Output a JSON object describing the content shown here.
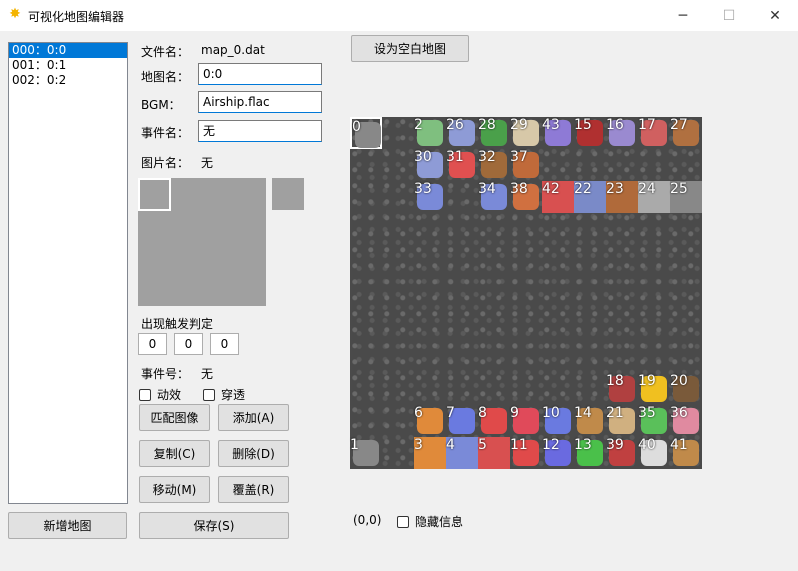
{
  "window": {
    "title": "可视化地图编辑器",
    "minimize": "─",
    "maximize": "☐",
    "close": "✕"
  },
  "maplist": {
    "items": [
      "000：0:0",
      "001：0:1",
      "002：0:2"
    ],
    "selected": 0
  },
  "form": {
    "filename_label": "文件名：",
    "filename_value": "map_0.dat",
    "mapname_label": "地图名：",
    "mapname_value": "0:0",
    "bgm_label": "BGM：",
    "bgm_value": "Airship.flac",
    "event_label": "事件名：",
    "event_value": "无",
    "image_label": "图片名：",
    "image_value": "无",
    "trigger_label": "出现触发判定",
    "trigger_values": [
      "0",
      "0",
      "0"
    ],
    "event_no_label": "事件号：",
    "event_no_value": "无",
    "anim_label": "动效",
    "pass_label": "穿透"
  },
  "buttons": {
    "set_blank": "设为空白地图",
    "match_image": "匹配图像",
    "add": "添加(A)",
    "copy": "复制(C)",
    "delete": "删除(D)",
    "move": "移动(M)",
    "overwrite": "覆盖(R)",
    "new_map": "新增地图",
    "save": "保存(S)"
  },
  "status": {
    "coords": "(0,0)",
    "hide_info_label": "隐藏信息"
  },
  "tiles": [
    {
      "num": "0",
      "icon": "stairs-up-icon",
      "color": "#888888"
    },
    {
      "num": "2",
      "icon": "green-slime-icon",
      "color": "#7fbf7f"
    },
    {
      "num": "26",
      "icon": "bat-icon",
      "color": "#8e9bd6"
    },
    {
      "num": "28",
      "icon": "green-zombie-icon",
      "color": "#4aa04a"
    },
    {
      "num": "29",
      "icon": "skeleton-icon",
      "color": "#d7c8a8"
    },
    {
      "num": "43",
      "icon": "purple-beast-icon",
      "color": "#8e7ad6"
    },
    {
      "num": "15",
      "icon": "red-web-icon",
      "color": "#b03030"
    },
    {
      "num": "16",
      "icon": "priest-icon",
      "color": "#9a8ad0"
    },
    {
      "num": "17",
      "icon": "red-crab-icon",
      "color": "#d06060"
    },
    {
      "num": "27",
      "icon": "brown-golem-icon",
      "color": "#b07040"
    },
    {
      "num": "30",
      "icon": "bat-icon",
      "color": "#8e9bd6"
    },
    {
      "num": "31",
      "icon": "red-slime-icon",
      "color": "#e05050"
    },
    {
      "num": "32",
      "icon": "brown-bird-icon",
      "color": "#a06a3a"
    },
    {
      "num": "37",
      "icon": "orange-golem-icon",
      "color": "#c06a3a"
    },
    {
      "num": "33",
      "icon": "blue-knight-icon",
      "color": "#7a8ad8"
    },
    {
      "num": "34",
      "icon": "blue-knight-icon",
      "color": "#7a8ad8"
    },
    {
      "num": "38",
      "icon": "orange-knight-icon",
      "color": "#d07040"
    },
    {
      "num": "42",
      "icon": "red-wall-icon",
      "color": "#d85050"
    },
    {
      "num": "22",
      "icon": "blue-wall-icon",
      "color": "#7a8ac8"
    },
    {
      "num": "23",
      "icon": "brick-wall-icon",
      "color": "#b06a3a"
    },
    {
      "num": "24",
      "icon": "stone-wall-icon",
      "color": "#aaaaaa"
    },
    {
      "num": "25",
      "icon": "gate-icon",
      "color": "#888888"
    },
    {
      "num": "18",
      "icon": "book-icon",
      "color": "#b04040"
    },
    {
      "num": "19",
      "icon": "star-icon",
      "color": "#f0c020"
    },
    {
      "num": "20",
      "icon": "pickaxe-icon",
      "color": "#7a5a3a"
    },
    {
      "num": "6",
      "icon": "orange-key-icon",
      "color": "#e08a3a"
    },
    {
      "num": "7",
      "icon": "blue-key-icon",
      "color": "#6a7ae0"
    },
    {
      "num": "8",
      "icon": "red-key-icon",
      "color": "#e04a4a"
    },
    {
      "num": "9",
      "icon": "red-potion-icon",
      "color": "#e04a5a"
    },
    {
      "num": "10",
      "icon": "blue-potion-icon",
      "color": "#6a7ae0"
    },
    {
      "num": "14",
      "icon": "coin-icon",
      "color": "#c08a4a"
    },
    {
      "num": "21",
      "icon": "scroll-icon",
      "color": "#d0b080"
    },
    {
      "num": "35",
      "icon": "green-pot-icon",
      "color": "#5ac05a"
    },
    {
      "num": "36",
      "icon": "pink-pot-icon",
      "color": "#e08aa0"
    },
    {
      "num": "1",
      "icon": "stairs-down-icon",
      "color": "#888888"
    },
    {
      "num": "3",
      "icon": "orange-door-icon",
      "color": "#e08a3a"
    },
    {
      "num": "4",
      "icon": "blue-door-icon",
      "color": "#7a8ad8"
    },
    {
      "num": "5",
      "icon": "red-door-icon",
      "color": "#d85050"
    },
    {
      "num": "11",
      "icon": "red-gem-icon",
      "color": "#e04a4a"
    },
    {
      "num": "12",
      "icon": "blue-gem-icon",
      "color": "#6a6ae0"
    },
    {
      "num": "13",
      "icon": "green-gem-icon",
      "color": "#4ac04a"
    },
    {
      "num": "39",
      "icon": "bomb-icon",
      "color": "#c04040"
    },
    {
      "num": "40",
      "icon": "snowflake-icon",
      "color": "#dddddd"
    },
    {
      "num": "41",
      "icon": "wing-icon",
      "color": "#c08a4a"
    }
  ]
}
